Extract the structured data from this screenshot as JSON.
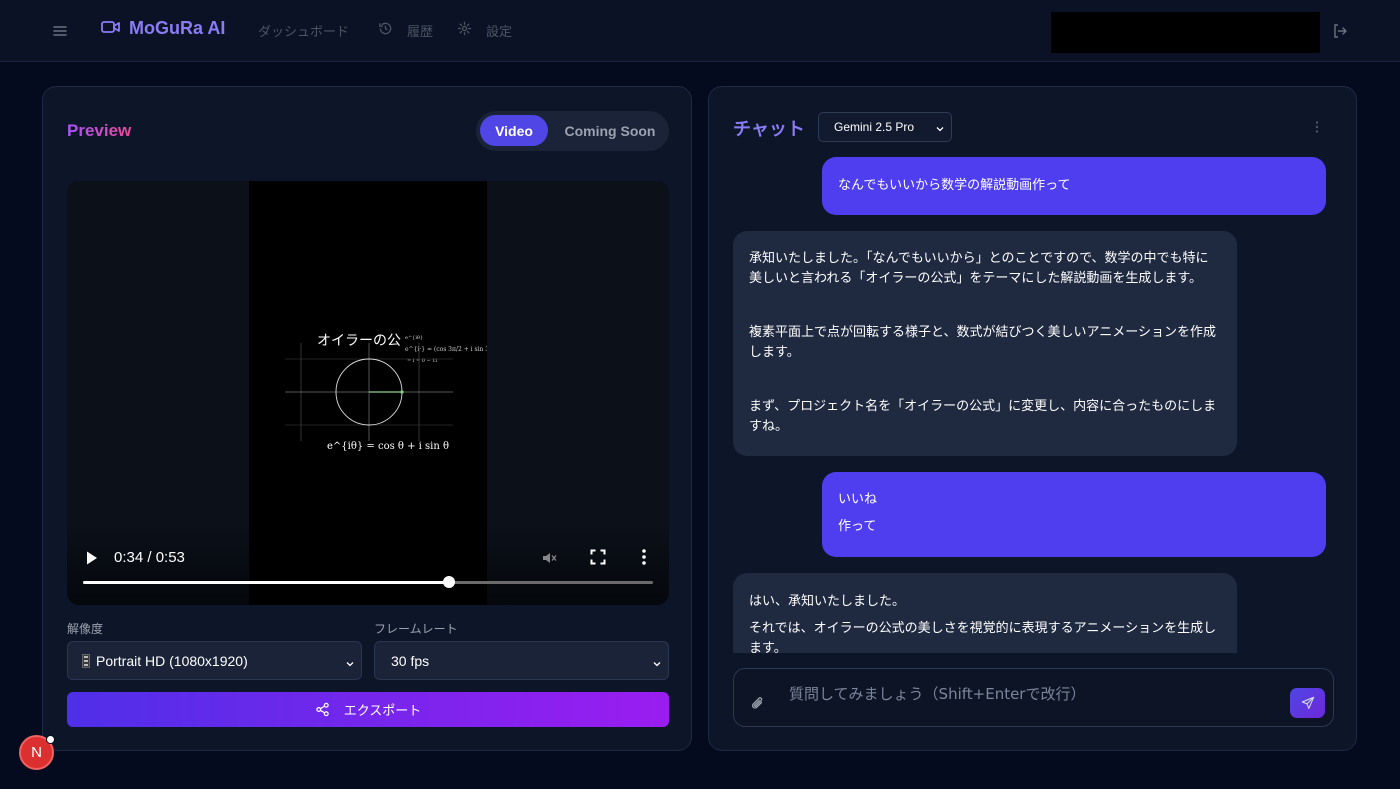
{
  "header": {
    "brand": "MoGuRa AI",
    "nav": {
      "dashboard": "ダッシュボード",
      "history": "履歴",
      "settings": "設定"
    }
  },
  "preview": {
    "title": "Preview",
    "tabs": {
      "video": "Video",
      "coming_soon": "Coming Soon"
    },
    "player": {
      "time": "0:34 / 0:53",
      "progress_fraction": 0.642,
      "frame_title": "オイラーの公",
      "frame_formula": "e^{iθ} = cos θ + i sin θ"
    },
    "resolution": {
      "label": "解像度",
      "value": "Portrait HD (1080x1920)",
      "icon": "film-icon"
    },
    "framerate": {
      "label": "フレームレート",
      "value": "30 fps"
    },
    "export_label": "エクスポート"
  },
  "chat": {
    "title": "チャット",
    "model": "Gemini 2.5 Pro",
    "messages": [
      {
        "role": "user",
        "lines": [
          "なんでもいいから数学の解説動画作って"
        ]
      },
      {
        "role": "assistant",
        "lines": [
          "承知いたしました。「なんでもいいから」とのことですので、数学の中でも特に美しいと言われる「オイラーの公式」をテーマにした解説動画を生成します。",
          "複素平面上で点が回転する様子と、数式が結びつく美しいアニメーションを作成します。",
          "まず、プロジェクト名を「オイラーの公式」に変更し、内容に合ったものにしますね。"
        ]
      },
      {
        "role": "user",
        "lines": [
          "いいね",
          "作って"
        ]
      },
      {
        "role": "assistant",
        "lines": [
          "はい、承知いたしました。",
          "それでは、オイラーの公式の美しさを視覚的に表現するアニメーションを生成します。"
        ]
      }
    ],
    "input_placeholder": "質問してみましょう（Shift+Enterで改行）"
  },
  "dev_badge": "N",
  "colors": {
    "accent": "#4f46e5",
    "user_bubble": "#4f3ef0",
    "assistant_bubble": "#1f2940",
    "background": "#050b1f"
  }
}
